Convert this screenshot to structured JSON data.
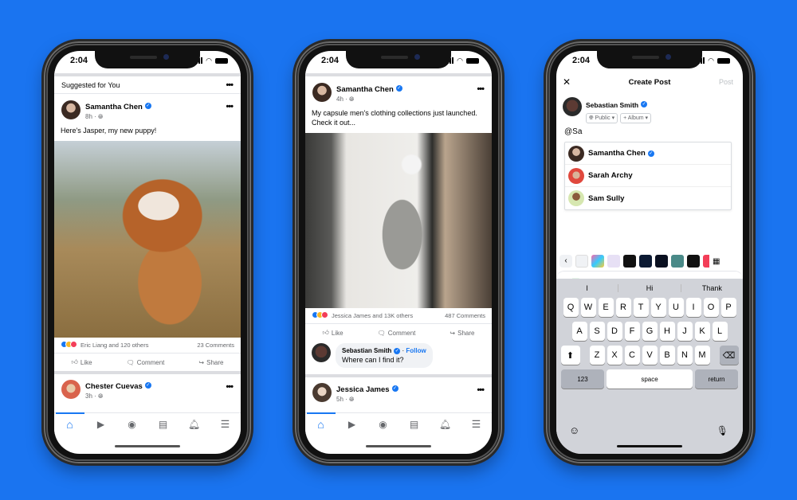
{
  "status_time": "2:04",
  "colors": {
    "background": "#1a74f0",
    "accent": "#1877f2",
    "like": "#1877f2",
    "wow": "#f7b928",
    "love": "#f33e58"
  },
  "phone1": {
    "section_title": "Suggested for You",
    "post": {
      "author": "Samantha Chen",
      "time": "8h",
      "privacy_icon": "globe-icon",
      "text": "Here's Jasper, my new puppy!",
      "image": "bulldog-puppy-photo",
      "reactions_text": "Eric Liang and 120 others",
      "comments": "23 Comments"
    },
    "actions": [
      "Like",
      "Comment",
      "Share"
    ],
    "next_post": {
      "author": "Chester Cuevas",
      "time": "3h"
    },
    "tabs": [
      "home-icon",
      "video-icon",
      "groups-icon",
      "news-icon",
      "bell-icon",
      "menu-icon"
    ]
  },
  "phone2": {
    "post": {
      "author": "Samantha Chen",
      "time": "4h",
      "text": "My capsule men's clothing collections just launched. Check it out...",
      "image": "clothing-store-photo",
      "reactions_text": "Jessica James and 13K others",
      "comments": "487 Comments"
    },
    "actions": [
      "Like",
      "Comment",
      "Share"
    ],
    "comment": {
      "author": "Sebastian Smith",
      "follow": "Follow",
      "text": "Where can I find it?"
    },
    "next_post": {
      "author": "Jessica James",
      "time": "5h"
    },
    "tabs": [
      "home-icon",
      "video-icon",
      "groups-icon",
      "news-icon",
      "bell-icon",
      "menu-icon"
    ]
  },
  "phone3": {
    "header": {
      "close": "✕",
      "title": "Create Post",
      "post_button": "Post"
    },
    "author": "Sebastian Smith",
    "audience": "Public",
    "album": "+ Album",
    "input_text": "@Sa",
    "mentions": [
      {
        "name": "Samantha Chen",
        "verified": true
      },
      {
        "name": "Sarah Archy",
        "verified": false
      },
      {
        "name": "Sam Sully",
        "verified": false
      }
    ],
    "composer_tools": [
      "photo-icon",
      "feeling-icon",
      "location-icon",
      "live-video-icon",
      "more-icon"
    ],
    "suggestions": [
      "I",
      "Hi",
      "Thank"
    ],
    "keyboard": {
      "row1": [
        "Q",
        "W",
        "E",
        "R",
        "T",
        "Y",
        "U",
        "I",
        "O",
        "P"
      ],
      "row2": [
        "A",
        "S",
        "D",
        "F",
        "G",
        "H",
        "J",
        "K",
        "L"
      ],
      "row3": [
        "Z",
        "X",
        "C",
        "V",
        "B",
        "N",
        "M"
      ],
      "numbers": "123",
      "space": "space",
      "return": "return"
    }
  }
}
